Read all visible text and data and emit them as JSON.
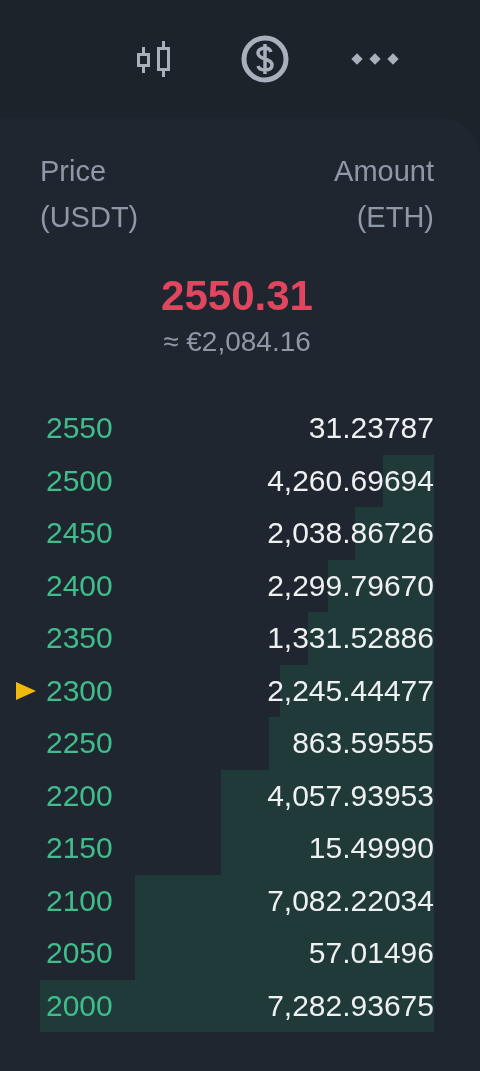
{
  "header": {
    "price_label": "Price",
    "price_unit": "(USDT)",
    "amount_label": "Amount",
    "amount_unit": "(ETH)"
  },
  "last_price": {
    "value": "2550.31",
    "converted": "≈ €2,084.16"
  },
  "rows": [
    {
      "price": "2550",
      "amount": "31.23787",
      "current": false
    },
    {
      "price": "2500",
      "amount": "4,260.69694",
      "level": 0.13,
      "current": false
    },
    {
      "price": "2450",
      "amount": "2,038.86726",
      "level": 0.2,
      "current": false
    },
    {
      "price": "2400",
      "amount": "2,299.79670",
      "level": 0.27,
      "current": false
    },
    {
      "price": "2350",
      "amount": "1,331.52886",
      "level": 0.32,
      "current": false
    },
    {
      "price": "2300",
      "amount": "2,245.44477",
      "level": 0.39,
      "current": true
    },
    {
      "price": "2250",
      "amount": "863.59555",
      "level": 0.42,
      "current": false
    },
    {
      "price": "2200",
      "amount": "4,057.93953",
      "level": 0.54,
      "current": false
    },
    {
      "price": "2150",
      "amount": "15.49990",
      "level": 0.54,
      "current": false
    },
    {
      "price": "2100",
      "amount": "7,082.22034",
      "level": 0.76,
      "current": false
    },
    {
      "price": "2050",
      "amount": "57.01496",
      "level": 0.76,
      "current": false
    },
    {
      "price": "2000",
      "amount": "7,282.93675",
      "level": 1,
      "current": false
    }
  ]
}
